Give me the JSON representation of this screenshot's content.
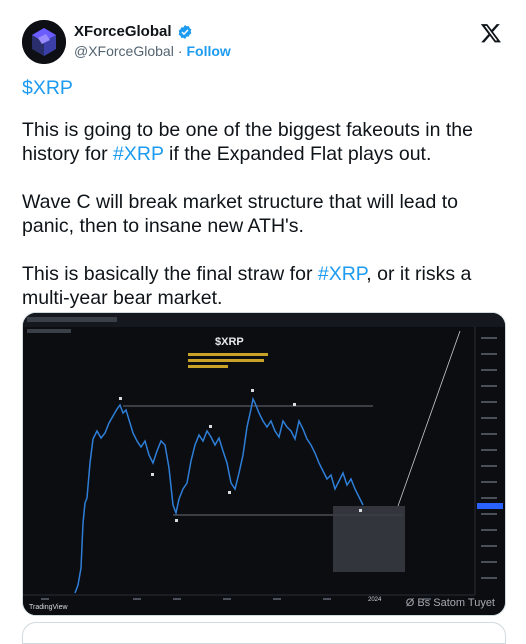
{
  "author": {
    "name": "XForceGlobal",
    "handle": "@XForceGlobal",
    "separator": "·",
    "follow_label": "Follow",
    "verified_icon": "verified-badge-icon"
  },
  "platform_icon": "x-logo-icon",
  "tweet": {
    "cashtag": "$XRP",
    "p1_before": "This is going to be one of the biggest fakeouts in the history for ",
    "p1_tag": "#XRP",
    "p1_after": " if the Expanded Flat plays out.",
    "p2": "Wave C will break market structure that will lead to panic, then to insane new ATH's.",
    "p3_before": "This is basically the final straw for ",
    "p3_tag": "#XRP",
    "p3_after": ", or it risks a multi-year bear market."
  },
  "chart_image": {
    "title": "$XRP",
    "brand": "TradingView",
    "x_tick_label": "2024"
  },
  "watermark": "Ø Bs Satom Tuyet"
}
